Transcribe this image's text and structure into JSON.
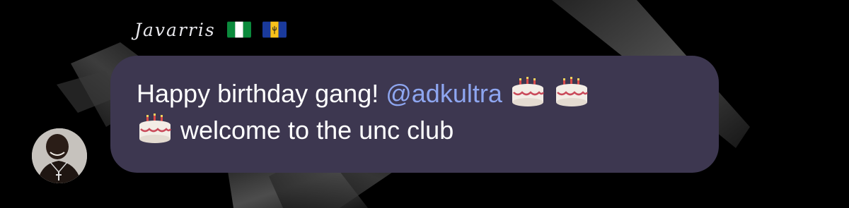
{
  "message": {
    "sender_name": "Javarris",
    "sender_flags": [
      "nigeria-flag-icon",
      "barbados-flag-icon"
    ],
    "line1_text": "Happy birthday gang! ",
    "mention": "@adkultra",
    "line2_text": " welcome to the unc club",
    "emojis": [
      "birthday-cake-icon",
      "birthday-cake-icon",
      "birthday-cake-icon"
    ]
  },
  "colors": {
    "background": "#000000",
    "bubble": "#3d3750",
    "mention": "#8ea6f0",
    "text": "#ffffff"
  }
}
